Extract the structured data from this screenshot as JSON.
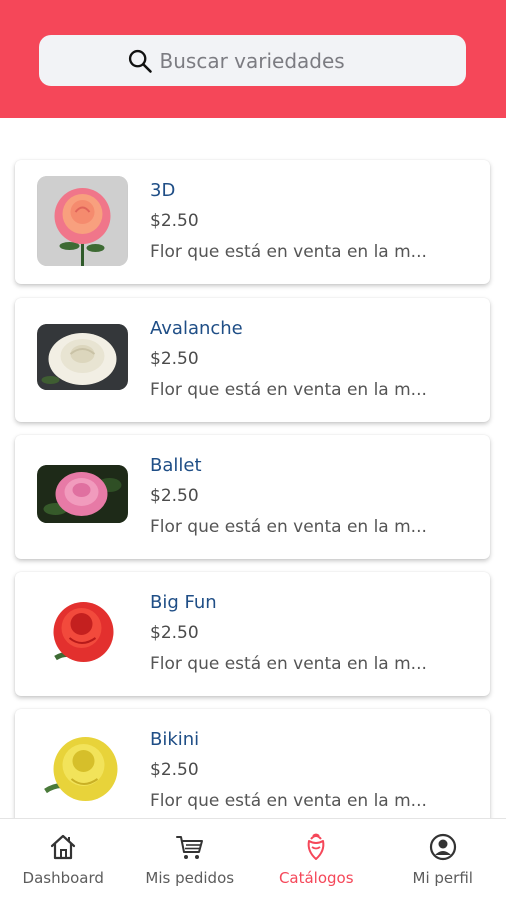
{
  "search": {
    "placeholder": "Buscar variedades",
    "icon": "search-icon"
  },
  "colors": {
    "accent": "#f54759",
    "title": "#1f4e86",
    "text": "#555555"
  },
  "products": [
    {
      "name": "3D",
      "price": "$2.50",
      "description": "Flor que está en venta en la m..."
    },
    {
      "name": "Avalanche",
      "price": "$2.50",
      "description": "Flor que está en venta en la m..."
    },
    {
      "name": "Ballet",
      "price": "$2.50",
      "description": "Flor que está en venta en la m..."
    },
    {
      "name": "Big Fun",
      "price": "$2.50",
      "description": "Flor que está en venta en la m..."
    },
    {
      "name": "Bikini",
      "price": "$2.50",
      "description": "Flor que está en venta en la m..."
    }
  ],
  "tabs": [
    {
      "label": "Dashboard",
      "icon": "home-icon",
      "active": false
    },
    {
      "label": "Mis pedidos",
      "icon": "cart-icon",
      "active": false
    },
    {
      "label": "Catálogos",
      "icon": "rose-icon",
      "active": true
    },
    {
      "label": "Mi perfil",
      "icon": "profile-icon",
      "active": false
    }
  ]
}
